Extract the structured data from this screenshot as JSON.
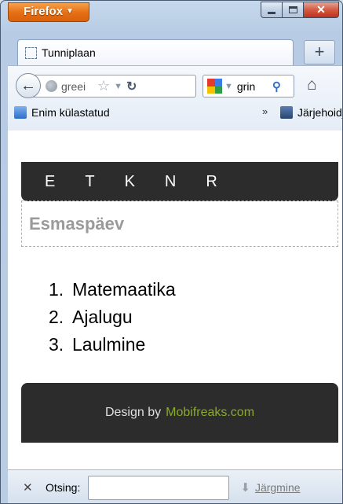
{
  "browser": {
    "app_button": "Firefox",
    "tab_title": "Tunniplaan",
    "new_tab": "+",
    "url": "greei",
    "search_query": "grin"
  },
  "bookmarks": [
    {
      "label": "Enim külastatud"
    },
    {
      "label": "Järjehoidjad"
    }
  ],
  "bookmarks_overflow": "»",
  "page": {
    "nav_days": [
      "E",
      "T",
      "K",
      "N",
      "R"
    ],
    "day_title": "Esmaspäev",
    "subjects": [
      {
        "num": "1.",
        "name": "Matemaatika"
      },
      {
        "num": "2.",
        "name": "Ajalugu"
      },
      {
        "num": "3.",
        "name": "Laulmine"
      }
    ],
    "footer_by": "Design by",
    "footer_brand": "Mobifreaks.com"
  },
  "findbar": {
    "label": "Otsing:",
    "value": "",
    "next_label": "Järgmine"
  },
  "colors": {
    "nav_bg": "#2c2c2c",
    "brand_green": "#8aaa2a",
    "firefox_orange": "#e66d12"
  }
}
